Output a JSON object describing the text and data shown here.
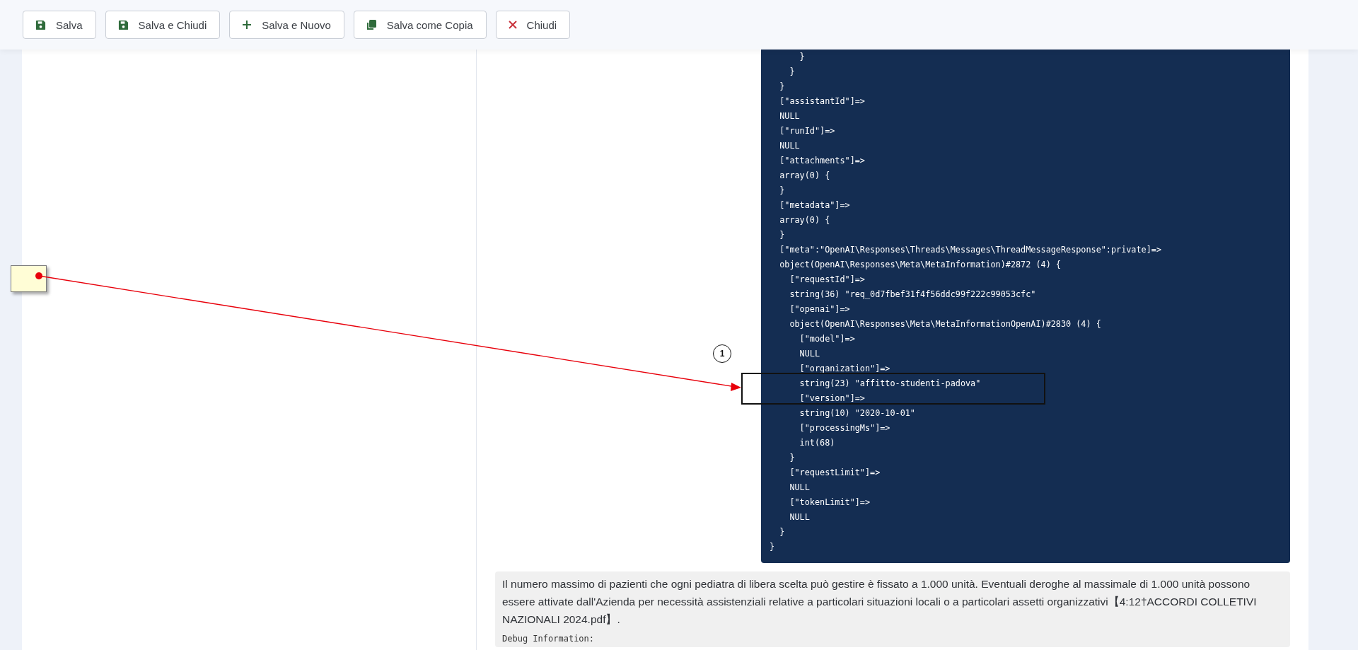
{
  "toolbar": {
    "buttons": [
      {
        "kind": "save",
        "label": "Salva"
      },
      {
        "kind": "save",
        "label": "Salva e Chiudi"
      },
      {
        "kind": "add",
        "label": "Salva e Nuovo"
      },
      {
        "kind": "copy",
        "label": "Salva come Copia"
      },
      {
        "kind": "close",
        "label": "Chiudi"
      }
    ]
  },
  "code_block": {
    "lines": [
      "      }",
      "    }",
      "  }",
      "  [\"assistantId\"]=>",
      "  NULL",
      "  [\"runId\"]=>",
      "  NULL",
      "  [\"attachments\"]=>",
      "  array(0) {",
      "  }",
      "  [\"metadata\"]=>",
      "  array(0) {",
      "  }",
      "  [\"meta\":\"OpenAI\\Responses\\Threads\\Messages\\ThreadMessageResponse\":private]=>",
      "  object(OpenAI\\Responses\\Meta\\MetaInformation)#2872 (4) {",
      "    [\"requestId\"]=>",
      "    string(36) \"req_0d7fbef31f4f56ddc99f222c99053cfc\"",
      "    [\"openai\"]=>",
      "    object(OpenAI\\Responses\\Meta\\MetaInformationOpenAI)#2830 (4) {",
      "      [\"model\"]=>",
      "      NULL",
      "      [\"organization\"]=>",
      "      string(23) \"affitto-studenti-padova\"",
      "      [\"version\"]=>",
      "      string(10) \"2020-10-01\"",
      "      [\"processingMs\"]=>",
      "      int(68)",
      "    }",
      "    [\"requestLimit\"]=>",
      "    NULL",
      "    [\"tokenLimit\"]=>",
      "    NULL",
      "  }",
      "}"
    ]
  },
  "message": {
    "text": "Il numero massimo di pazienti che ogni pediatra di libera scelta può gestire è fissato a 1.000 unità. Eventuali deroghe al massimale di 1.000 unità possono essere attivate dall'Azienda per necessità assistenziali relative a particolari situazioni locali o a particolari assetti organizzativi【4:12†ACCORDI COLLETIVI NAZIONALI 2024.pdf】.",
    "debug_label": "Debug Information:"
  },
  "annotations": {
    "callout_number": "1"
  }
}
